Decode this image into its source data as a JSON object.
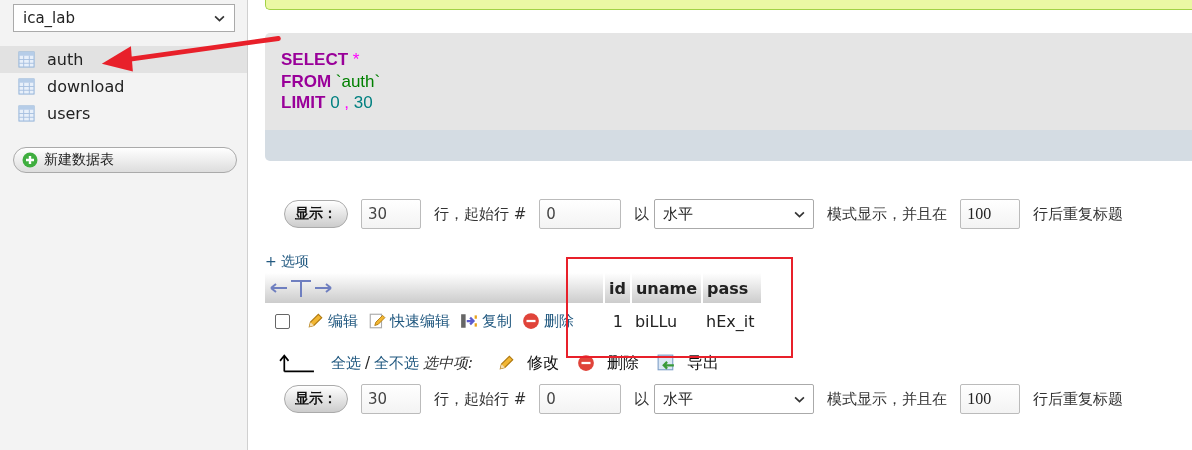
{
  "sidebar": {
    "database_select": "ica_lab",
    "tables": [
      {
        "name": "auth",
        "selected": true
      },
      {
        "name": "download",
        "selected": false
      },
      {
        "name": "users",
        "selected": false
      }
    ],
    "new_table_button": "新建数据表"
  },
  "sql": {
    "lines": [
      [
        {
          "kind": "keyword",
          "text": "SELECT"
        },
        {
          "kind": "punct",
          "text": "*"
        }
      ],
      [
        {
          "kind": "keyword",
          "text": "FROM"
        },
        {
          "kind": "string",
          "text": "`auth`"
        }
      ],
      [
        {
          "kind": "keyword",
          "text": "LIMIT"
        },
        {
          "kind": "number",
          "text": "0"
        },
        {
          "kind": "punct",
          "text": ","
        },
        {
          "kind": "number",
          "text": "30"
        }
      ]
    ]
  },
  "display_controls": [
    {
      "button": "显示：",
      "rows": "30",
      "label_rows": "行，起始行 #",
      "start": "0",
      "label_by": "以",
      "mode": "水平",
      "label_mode": "模式显示，并且在",
      "repeat": "100",
      "label_repeat": "行后重复标题"
    },
    {
      "button": "显示：",
      "rows": "30",
      "label_rows": "行，起始行 #",
      "start": "0",
      "label_by": "以",
      "mode": "水平",
      "label_mode": "模式显示，并且在",
      "repeat": "100",
      "label_repeat": "行后重复标题"
    }
  ],
  "options_link": "+ 选项",
  "table": {
    "columns": [
      "id",
      "uname",
      "pass"
    ],
    "rows": [
      {
        "checked": false,
        "actions": [
          {
            "kind": "edit",
            "label": "编辑"
          },
          {
            "kind": "quick_edit",
            "label": "快速编辑"
          },
          {
            "kind": "copy",
            "label": "复制"
          },
          {
            "kind": "delete",
            "label": "删除"
          }
        ],
        "cells": [
          "1",
          "biLLu",
          "hEx_it"
        ]
      }
    ]
  },
  "bulk": {
    "select_all": "全选",
    "separator": "/",
    "select_none": "全不选",
    "with_selected": "选中项:",
    "actions": [
      {
        "kind": "edit",
        "label": "修改"
      },
      {
        "kind": "delete",
        "label": "删除"
      },
      {
        "kind": "export",
        "label": "导出"
      }
    ]
  }
}
